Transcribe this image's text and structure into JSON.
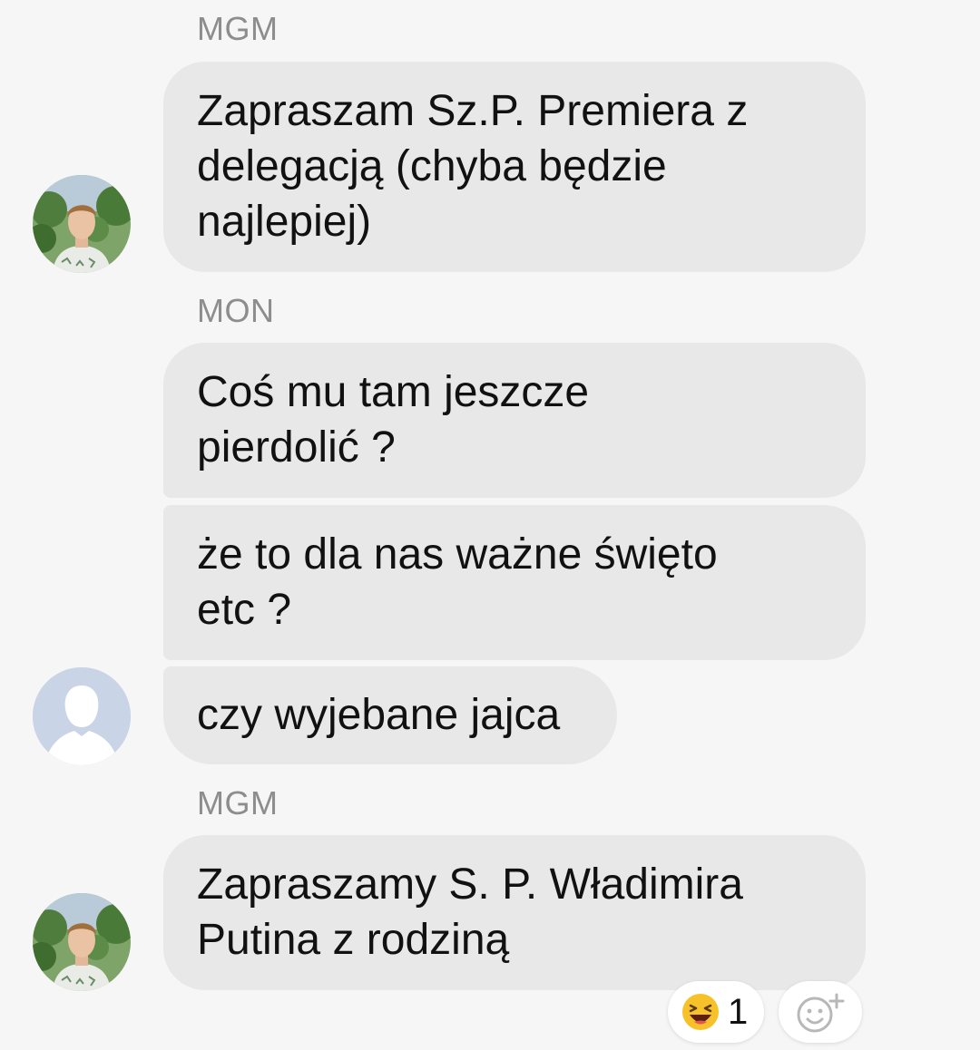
{
  "messages": {
    "group1": {
      "sender": "MGM",
      "text_lines": [
        "Zapraszam Sz.P. Premiera z",
        "delegacją (chyba będzie",
        "najlepiej)"
      ]
    },
    "group2": {
      "sender": "MON",
      "bubble1_lines": [
        "Coś mu tam jeszcze",
        "pierdolić ?"
      ],
      "bubble2_lines": [
        "że to dla nas ważne święto",
        "etc ?"
      ],
      "bubble3_lines": [
        "czy wyjebane jajca"
      ]
    },
    "group3": {
      "sender": "MGM",
      "text_lines": [
        "Zapraszamy S. P. Władimira",
        "Putina z rodziną"
      ]
    }
  },
  "reactions": {
    "laugh_emoji": "😆",
    "laugh_count": "1",
    "add_reaction_icon": "add-reaction-icon"
  },
  "colors": {
    "background": "#f6f6f6",
    "bubble": "#e8e8e8",
    "sender_name": "#8d8d8d",
    "placeholder_avatar": "#c9d4e6"
  }
}
